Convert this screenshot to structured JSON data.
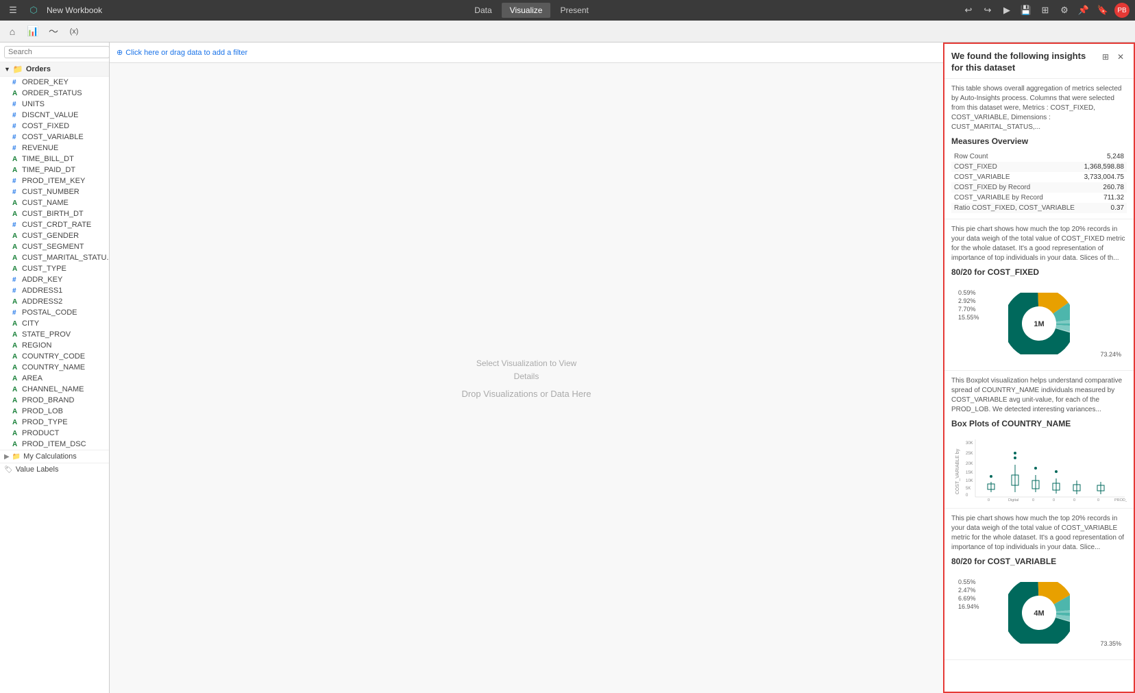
{
  "topbar": {
    "title": "New Workbook",
    "tabs": [
      "Data",
      "Visualize",
      "Present"
    ],
    "active_tab": "Visualize"
  },
  "toolbar": {
    "icons": [
      "home-icon",
      "bar-chart-icon",
      "line-icon",
      "fx-icon"
    ]
  },
  "filter_bar": {
    "placeholder": "Click here or drag data to add a filter"
  },
  "canvas": {
    "select_hint": "Select Visualization to View\nDetails",
    "drop_hint": "Drop Visualizations or Data Here"
  },
  "search": {
    "placeholder": "Search"
  },
  "tree": {
    "group_label": "Orders",
    "items": [
      {
        "type": "#",
        "label": "ORDER_KEY"
      },
      {
        "type": "A",
        "label": "ORDER_STATUS"
      },
      {
        "type": "#",
        "label": "UNITS"
      },
      {
        "type": "#",
        "label": "DISCNT_VALUE"
      },
      {
        "type": "#",
        "label": "COST_FIXED"
      },
      {
        "type": "#",
        "label": "COST_VARIABLE"
      },
      {
        "type": "#",
        "label": "REVENUE"
      },
      {
        "type": "A",
        "label": "TIME_BILL_DT"
      },
      {
        "type": "A",
        "label": "TIME_PAID_DT"
      },
      {
        "type": "#",
        "label": "PROD_ITEM_KEY"
      },
      {
        "type": "#",
        "label": "CUST_NUMBER"
      },
      {
        "type": "A",
        "label": "CUST_NAME"
      },
      {
        "type": "A",
        "label": "CUST_BIRTH_DT"
      },
      {
        "type": "#",
        "label": "CUST_CRDT_RATE"
      },
      {
        "type": "A",
        "label": "CUST_GENDER"
      },
      {
        "type": "A",
        "label": "CUST_SEGMENT"
      },
      {
        "type": "A",
        "label": "CUST_MARITAL_STATU..."
      },
      {
        "type": "A",
        "label": "CUST_TYPE"
      },
      {
        "type": "#",
        "label": "ADDR_KEY"
      },
      {
        "type": "#",
        "label": "ADDRESS1"
      },
      {
        "type": "A",
        "label": "ADDRESS2"
      },
      {
        "type": "#",
        "label": "POSTAL_CODE"
      },
      {
        "type": "A",
        "label": "CITY"
      },
      {
        "type": "A",
        "label": "STATE_PROV"
      },
      {
        "type": "A",
        "label": "REGION"
      },
      {
        "type": "A",
        "label": "COUNTRY_CODE"
      },
      {
        "type": "A",
        "label": "COUNTRY_NAME"
      },
      {
        "type": "A",
        "label": "AREA"
      },
      {
        "type": "A",
        "label": "CHANNEL_NAME"
      },
      {
        "type": "A",
        "label": "PROD_BRAND"
      },
      {
        "type": "A",
        "label": "PROD_LOB"
      },
      {
        "type": "A",
        "label": "PROD_TYPE"
      },
      {
        "type": "A",
        "label": "PRODUCT"
      },
      {
        "type": "A",
        "label": "PROD_ITEM_DSC"
      }
    ],
    "sub_groups": [
      {
        "label": "My Calculations"
      },
      {
        "label": "Value Labels"
      }
    ]
  },
  "insights": {
    "title": "We found the following insights for this dataset",
    "description": "This table shows overall aggregation of metrics selected by Auto-Insights process. Columns that were selected from this dataset were, Metrics : COST_FIXED, COST_VARIABLE, Dimensions : CUST_MARITAL_STATUS,...",
    "measures_overview": {
      "title": "Measures Overview",
      "rows": [
        {
          "label": "Row Count",
          "value": "5,248"
        },
        {
          "label": "COST_FIXED",
          "value": "1,368,598.88"
        },
        {
          "label": "COST_VARIABLE",
          "value": "3,733,004.75"
        },
        {
          "label": "COST_FIXED by Record",
          "value": "260.78"
        },
        {
          "label": "COST_VARIABLE by Record",
          "value": "711.32"
        },
        {
          "label": "Ratio COST_FIXED, COST_VARIABLE",
          "value": "0.37"
        }
      ]
    },
    "pie_cost_fixed": {
      "description": "This pie chart shows how much the top 20% records in your data weigh of the total value of COST_FIXED metric for the whole dataset. It's a good representation of importance of top individuals in your data. Slices of th...",
      "title": "80/20 for COST_FIXED",
      "labels_left": [
        "0.59%",
        "2.92%",
        "7.70%",
        "15.55%"
      ],
      "label_bottom": "73.24%",
      "center": "1M",
      "segments": [
        {
          "pct": 73.24,
          "color": "#00695c"
        },
        {
          "pct": 15.55,
          "color": "#e8a000"
        },
        {
          "pct": 7.7,
          "color": "#4db6ac"
        },
        {
          "pct": 2.92,
          "color": "#80cbc4"
        },
        {
          "pct": 0.59,
          "color": "#b2dfdb"
        }
      ]
    },
    "boxplot": {
      "description": "This Boxplot visualization helps understand comparative spread of COUNTRY_NAME individuals measured by COST_VARIABLE avg unit-value, for each of the PROD_LOB. We detected interesting variances...",
      "title": "Box Plots of COUNTRY_NAME",
      "y_label": "COST_VARIABLE by",
      "x_label": "PROD_LOB",
      "categories": [
        "0",
        "Digital",
        "0",
        "0",
        "0",
        "0",
        "0"
      ]
    },
    "pie_cost_variable": {
      "description": "This pie chart shows how much the top 20% records in your data weigh of the total value of COST_VARIABLE metric for the whole dataset. It's a good representation of importance of top individuals in your data. Slice...",
      "title": "80/20 for COST_VARIABLE",
      "labels_left": [
        "0.55%",
        "2.47%",
        "6.69%",
        "16.94%"
      ],
      "label_bottom": "73.35%",
      "center": "4M",
      "segments": [
        {
          "pct": 73.35,
          "color": "#00695c"
        },
        {
          "pct": 16.94,
          "color": "#e8a000"
        },
        {
          "pct": 6.69,
          "color": "#4db6ac"
        },
        {
          "pct": 2.47,
          "color": "#80cbc4"
        },
        {
          "pct": 0.55,
          "color": "#b2dfdb"
        }
      ]
    }
  }
}
